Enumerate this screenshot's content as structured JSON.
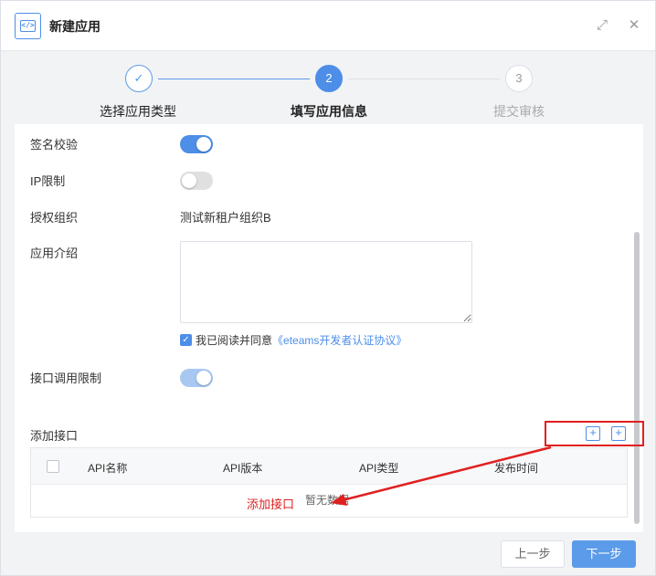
{
  "dialog": {
    "title": "新建应用",
    "app_icon_text": "</>",
    "maximize_glyph": "⤢",
    "close_glyph": "✕"
  },
  "steps": [
    {
      "number": "✓",
      "label": "选择应用类型",
      "state": "done"
    },
    {
      "number": "2",
      "label": "填写应用信息",
      "state": "active"
    },
    {
      "number": "3",
      "label": "提交审核",
      "state": "pending"
    }
  ],
  "form": {
    "signature_label": "签名校验",
    "signature_on": true,
    "ip_limit_label": "IP限制",
    "ip_limit_on": false,
    "auth_org_label": "授权组织",
    "auth_org_value": "测试新租户组织B",
    "intro_label": "应用介绍",
    "intro_value": "",
    "agree_text": "我已阅读并同意",
    "agree_link": "《eteams开发者认证协议》",
    "agree_checked": true,
    "rate_limit_label": "接口调用限制",
    "rate_limit_on": true,
    "add_api_label": "添加接口"
  },
  "table": {
    "columns": [
      "API名称",
      "API版本",
      "API类型",
      "发布时间"
    ],
    "rows": [],
    "empty_text": "暂无数据"
  },
  "annotation": {
    "text": "添加接口",
    "color": "#e02020"
  },
  "footer": {
    "prev_label": "上一步",
    "next_label": "下一步"
  },
  "colors": {
    "primary": "#4d8ee8",
    "annotation": "#e02020"
  }
}
